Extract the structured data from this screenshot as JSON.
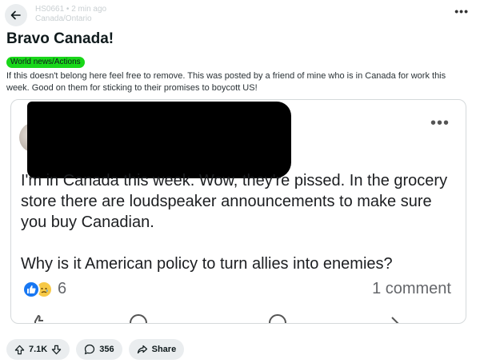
{
  "header": {
    "author": "HS0661 • 2 min ago",
    "subtext": "Canada/Ontario"
  },
  "post": {
    "title": "Bravo Canada!",
    "flair": "World news/Actions",
    "body": "If this doesn't belong here feel free to remove. This was posted by a friend of mine who is in Canada for work this week. Good on them for sticking to their promises to boycott US!"
  },
  "embedded_post": {
    "text": "I'm in Canada this week.  Wow, they're pissed.   In the grocery store there are loudspeaker announcements to make sure you buy Canadian.\n\nWhy is it American policy to turn allies into enemies?",
    "reaction_count": "6",
    "comments": "1 comment"
  },
  "actions": {
    "votes": "7.1K",
    "comments": "356",
    "share": "Share"
  },
  "colors": {
    "flair": "#19d719",
    "pill_bg": "#eaedef",
    "like_blue": "#1877f2"
  }
}
